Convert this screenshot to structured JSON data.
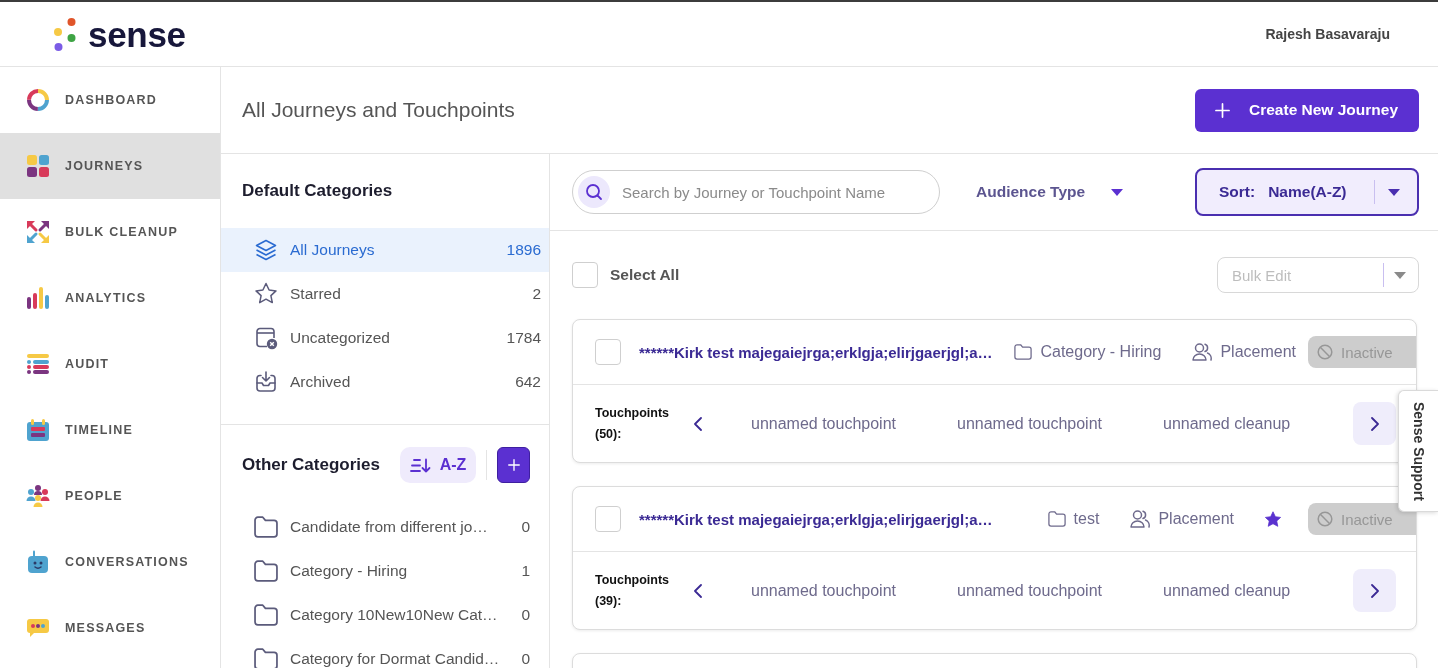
{
  "header": {
    "logo": "sense",
    "user_name": "Rajesh Basavaraju"
  },
  "nav": [
    {
      "label": "DASHBOARD",
      "selected": false
    },
    {
      "label": "JOURNEYS",
      "selected": true
    },
    {
      "label": "BULK CLEANUP",
      "selected": false
    },
    {
      "label": "ANALYTICS",
      "selected": false
    },
    {
      "label": "AUDIT",
      "selected": false
    },
    {
      "label": "TIMELINE",
      "selected": false
    },
    {
      "label": "PEOPLE",
      "selected": false
    },
    {
      "label": "CONVERSATIONS",
      "selected": false
    },
    {
      "label": "MESSAGES",
      "selected": false
    }
  ],
  "page": {
    "title": "All Journeys and Touchpoints",
    "create_button": "Create New Journey"
  },
  "default_categories": {
    "title": "Default Categories",
    "items": [
      {
        "label": "All Journeys",
        "count": "1896",
        "selected": true
      },
      {
        "label": "Starred",
        "count": "2",
        "selected": false
      },
      {
        "label": "Uncategorized",
        "count": "1784",
        "selected": false
      },
      {
        "label": "Archived",
        "count": "642",
        "selected": false
      }
    ]
  },
  "other_categories": {
    "title": "Other Categories",
    "sort_button": "A-Z",
    "items": [
      {
        "label": "Candidate from different jo…",
        "count": "0",
        "selected": false
      },
      {
        "label": "Category - Hiring",
        "count": "1",
        "selected": false
      },
      {
        "label": "Category 10New10New Cat…",
        "count": "0",
        "selected": false
      },
      {
        "label": "Category for Dormat Candid…",
        "count": "0",
        "selected": false
      }
    ]
  },
  "filters": {
    "search": {
      "placeholder": "Search by Journey or Touchpoint Name"
    },
    "audience": {
      "label": "Audience Type"
    },
    "sort": {
      "label": "Sort:",
      "value": "Name(A-Z)"
    }
  },
  "select_all": {
    "label": "Select All",
    "checked": false
  },
  "bulk_edit": {
    "placeholder": "Bulk Edit",
    "disabled": true
  },
  "cards": [
    {
      "checked": false,
      "title": "******Kirk test majegaiejrga;erklgja;elirjgaerjgl;a…",
      "category": "Category - Hiring",
      "audience": "Placement",
      "starred": false,
      "status": "Inactive",
      "touchpoints_label": "Touchpoints (50):",
      "touchpoints": [
        "unnamed touchpoint",
        "unnamed touchpoint",
        "unnamed cleanup"
      ]
    },
    {
      "checked": false,
      "title": "******Kirk test majegaiejrga;erklgja;elirjgaerjgl;a…",
      "category": "test",
      "audience": "Placement",
      "starred": true,
      "status": "Inactive",
      "touchpoints_label": "Touchpoints (39):",
      "touchpoints": [
        "unnamed touchpoint",
        "unnamed touchpoint",
        "unnamed cleanup"
      ]
    }
  ],
  "support_tab": {
    "label": "Sense Support"
  }
}
